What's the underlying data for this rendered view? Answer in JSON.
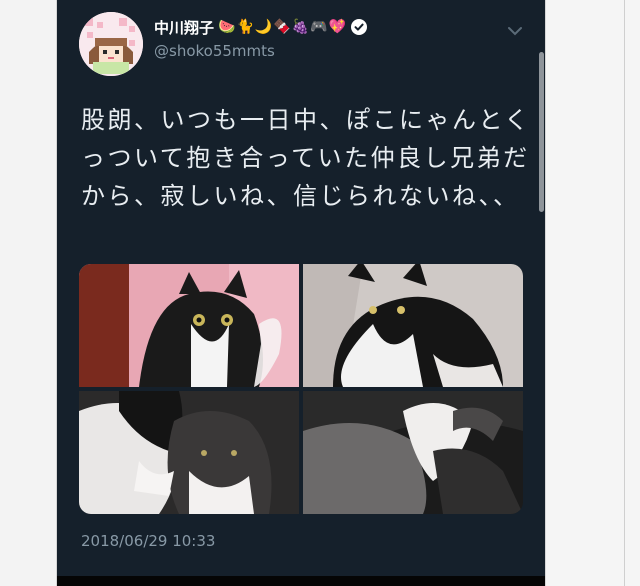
{
  "tweet": {
    "display_name": "中川翔子",
    "name_emojis": [
      "🍉",
      "🐈",
      "🌙",
      "🍫",
      "🍇",
      "🎮",
      "💖"
    ],
    "handle": "@shoko55mmts",
    "text": "股朗、いつも一日中、ぽこにゃんとくっついて抱き合っていた仲良し兄弟だから、寂しいね、信じられないね、、",
    "timestamp": "2018/06/29 10:33",
    "photos": [
      {
        "alt": "black-and-white cat on pink background",
        "background": "#e8a7b4"
      },
      {
        "alt": "black-and-white cat hugging",
        "background": "#c9c3c0"
      },
      {
        "alt": "two cats lying together",
        "background": "#2b2a2a"
      },
      {
        "alt": "close-up of grey and white cat fur",
        "background": "#1b1b1b"
      }
    ]
  },
  "colors": {
    "card_background": "#15202b",
    "text": "#e8edf1",
    "secondary_text": "#8899a6",
    "page_background": "#ffffff"
  },
  "icons": [
    "avatar-icon",
    "verified-badge-icon",
    "chevron-down-icon"
  ]
}
